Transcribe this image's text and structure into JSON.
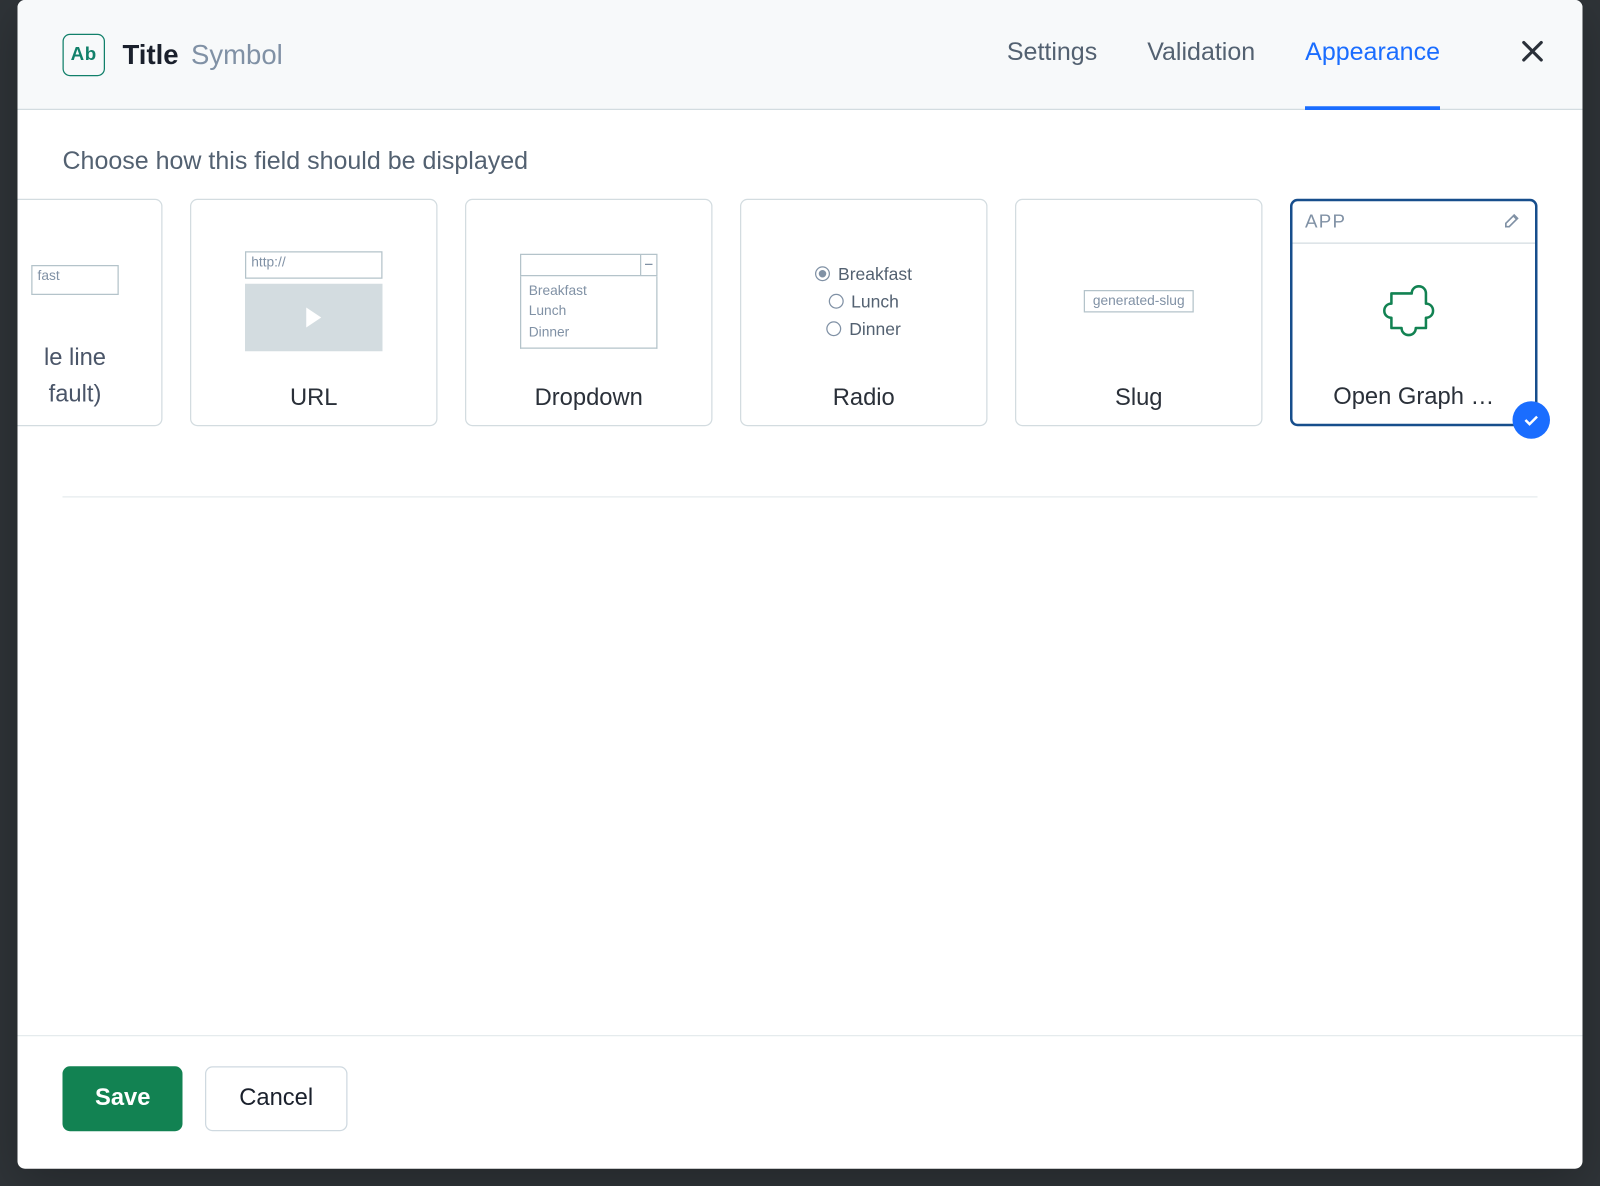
{
  "header": {
    "icon_text": "Ab",
    "title": "Title",
    "type": "Symbol",
    "tabs": [
      "Settings",
      "Validation",
      "Appearance"
    ],
    "active_tab": "Appearance"
  },
  "body": {
    "section_label": "Choose how this field should be displayed",
    "cards": [
      {
        "id": "single-line",
        "label_line1": "le line",
        "label_line2": "fault)",
        "input_text": "fast"
      },
      {
        "id": "url",
        "label": "URL",
        "url_placeholder": "http://"
      },
      {
        "id": "dropdown",
        "label": "Dropdown",
        "options": [
          "Breakfast",
          "Lunch",
          "Dinner"
        ]
      },
      {
        "id": "radio",
        "label": "Radio",
        "options": [
          "Breakfast",
          "Lunch",
          "Dinner"
        ],
        "selected": "Breakfast"
      },
      {
        "id": "slug",
        "label": "Slug",
        "slug_text": "generated-slug"
      },
      {
        "id": "open-graph",
        "label": "Open Graph …",
        "badge": "APP",
        "selected": true
      }
    ]
  },
  "footer": {
    "save": "Save",
    "cancel": "Cancel"
  }
}
